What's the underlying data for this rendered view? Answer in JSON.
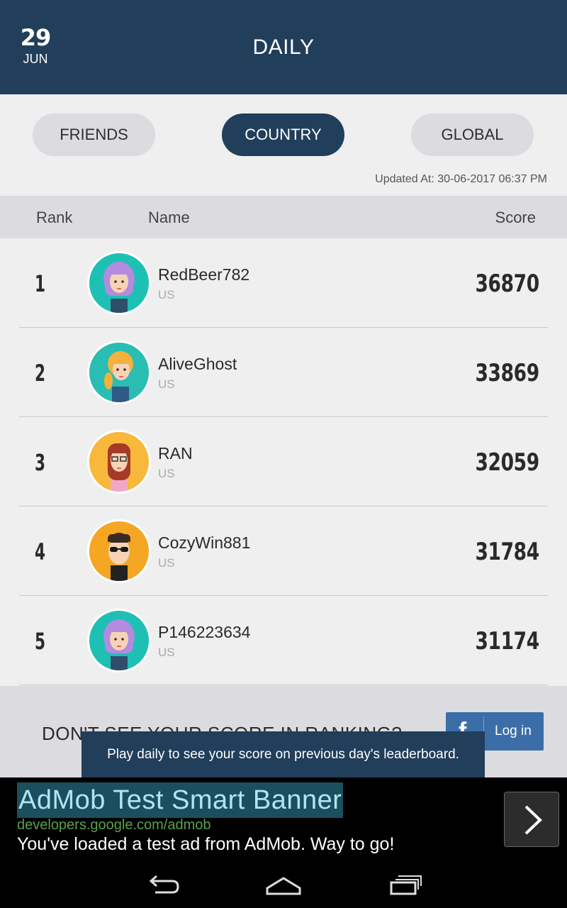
{
  "header": {
    "date_day": "29",
    "date_month": "JUN",
    "title": "DAILY"
  },
  "tabs": [
    {
      "label": "FRIENDS",
      "active": false
    },
    {
      "label": "COUNTRY",
      "active": true
    },
    {
      "label": "GLOBAL",
      "active": false
    }
  ],
  "updated_at": "Updated At: 30-06-2017 06:37 PM",
  "columns": {
    "rank": "Rank",
    "name": "Name",
    "score": "Score"
  },
  "rows": [
    {
      "rank": "1",
      "name": "RedBeer782",
      "country": "US",
      "score": "36870",
      "avatar": "purple-hair-girl-avatar"
    },
    {
      "rank": "2",
      "name": "AliveGhost",
      "country": "US",
      "score": "33869",
      "avatar": "blonde-girl-avatar"
    },
    {
      "rank": "3",
      "name": "RAN",
      "country": "US",
      "score": "32059",
      "avatar": "glasses-girl-avatar"
    },
    {
      "rank": "4",
      "name": "CozyWin881",
      "country": "US",
      "score": "31784",
      "avatar": "sunglasses-man-avatar"
    },
    {
      "rank": "5",
      "name": "P146223634",
      "country": "US",
      "score": "31174",
      "avatar": "purple-hair-girl-avatar"
    }
  ],
  "prompt": {
    "text": "DON'T SEE YOUR SCORE IN RANKING?",
    "fb_login_label": "Log in",
    "fb_icon": "facebook-icon"
  },
  "toast": "Play daily to see your score on previous day's leaderboard.",
  "ad": {
    "title": "AdMob Test Smart Banner",
    "url": "developers.google.com/admob",
    "text": "You've loaded a test ad from AdMob. Way to go!",
    "arrow_icon": "chevron-right-icon"
  },
  "navbar": {
    "icons": [
      "back-icon",
      "home-icon",
      "recents-icon"
    ]
  },
  "colors": {
    "primary": "#213e5a",
    "tab_inactive": "#dcdbe0",
    "background": "#efefef",
    "facebook": "#3b6ea8"
  }
}
